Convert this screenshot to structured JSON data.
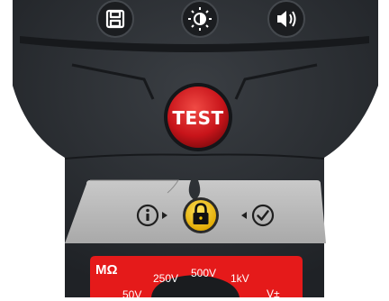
{
  "toolbar": {
    "save_icon": "save-icon",
    "brightness_icon": "brightness-icon",
    "volume_icon": "speaker-icon"
  },
  "test_button": {
    "label": "TEST",
    "color": "#d3131a"
  },
  "control_panel": {
    "info_icon": "info-icon",
    "lock_icon": "lock-icon",
    "confirm_icon": "check-icon",
    "lock_color": "#f5c400"
  },
  "dial": {
    "unit_label": "MΩ",
    "voltages": [
      "50V",
      "250V",
      "500V",
      "1kV",
      "V±"
    ],
    "band_color": "#e51a1a"
  },
  "colors": {
    "body": "#2a2d31",
    "panel": "#b9b9b9"
  }
}
